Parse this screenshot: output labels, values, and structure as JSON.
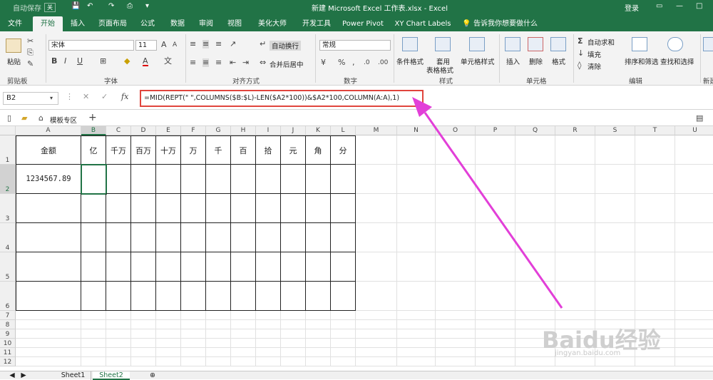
{
  "titlebar": {
    "autosave": "自动保存",
    "autosave_state": "关",
    "title": "新建 Microsoft Excel 工作表.xlsx  -  Excel",
    "login": "登录"
  },
  "tabs": [
    "文件",
    "开始",
    "插入",
    "页面布局",
    "公式",
    "数据",
    "审阅",
    "视图",
    "美化大师",
    "开发工具",
    "Power Pivot",
    "XY Chart Labels"
  ],
  "tell_me": "告诉我你想要做什么",
  "ribbon": {
    "paste": "粘贴",
    "clipboard": "剪贴板",
    "font_name": "宋体",
    "font_size": "11",
    "font_group": "字体",
    "wrap_text": "自动换行",
    "merge_center": "合并后居中",
    "align_group": "对齐方式",
    "number_format": "常规",
    "number_group": "数字",
    "cond_format": "条件格式",
    "table_format_1": "套用",
    "table_format_2": "表格格式",
    "cell_style": "单元格样式",
    "styles_group": "样式",
    "insert": "插入",
    "delete": "删除",
    "format": "格式",
    "cells_group": "单元格",
    "autosum": "自动求和",
    "fill": "填充",
    "clear": "清除",
    "sort_filter": "排序和筛选",
    "find_select": "查找和选择",
    "edit_group": "编辑",
    "new_group": "新建"
  },
  "formula_bar": {
    "name_box": "B2",
    "fx": "fx",
    "formula": "=MID(REPT(\" \",COLUMNS($B:$L)-LEN($A2*100))&$A2*100,COLUMN(A:A),1)"
  },
  "template_bar": {
    "label": "模板专区",
    "add": "+"
  },
  "columns": [
    "A",
    "B",
    "C",
    "D",
    "E",
    "F",
    "G",
    "H",
    "I",
    "J",
    "K",
    "L",
    "M",
    "N",
    "O",
    "P",
    "Q",
    "R",
    "S",
    "T",
    "U"
  ],
  "rows": [
    "1",
    "2",
    "3",
    "4",
    "5",
    "6",
    "7",
    "8",
    "9",
    "10",
    "11",
    "12"
  ],
  "table": {
    "headers": [
      "金额",
      "亿",
      "千万",
      "百万",
      "十万",
      "万",
      "千",
      "百",
      "拾",
      "元",
      "角",
      "分"
    ],
    "amount": "1234567.89"
  },
  "sheets": [
    "Sheet1",
    "Sheet2"
  ],
  "accent": "#217346",
  "highlight": "#e0453d",
  "arrow": "#e23fd8",
  "watermark": {
    "brand": "Baidu经验",
    "url": "jingyan.baidu.com"
  }
}
